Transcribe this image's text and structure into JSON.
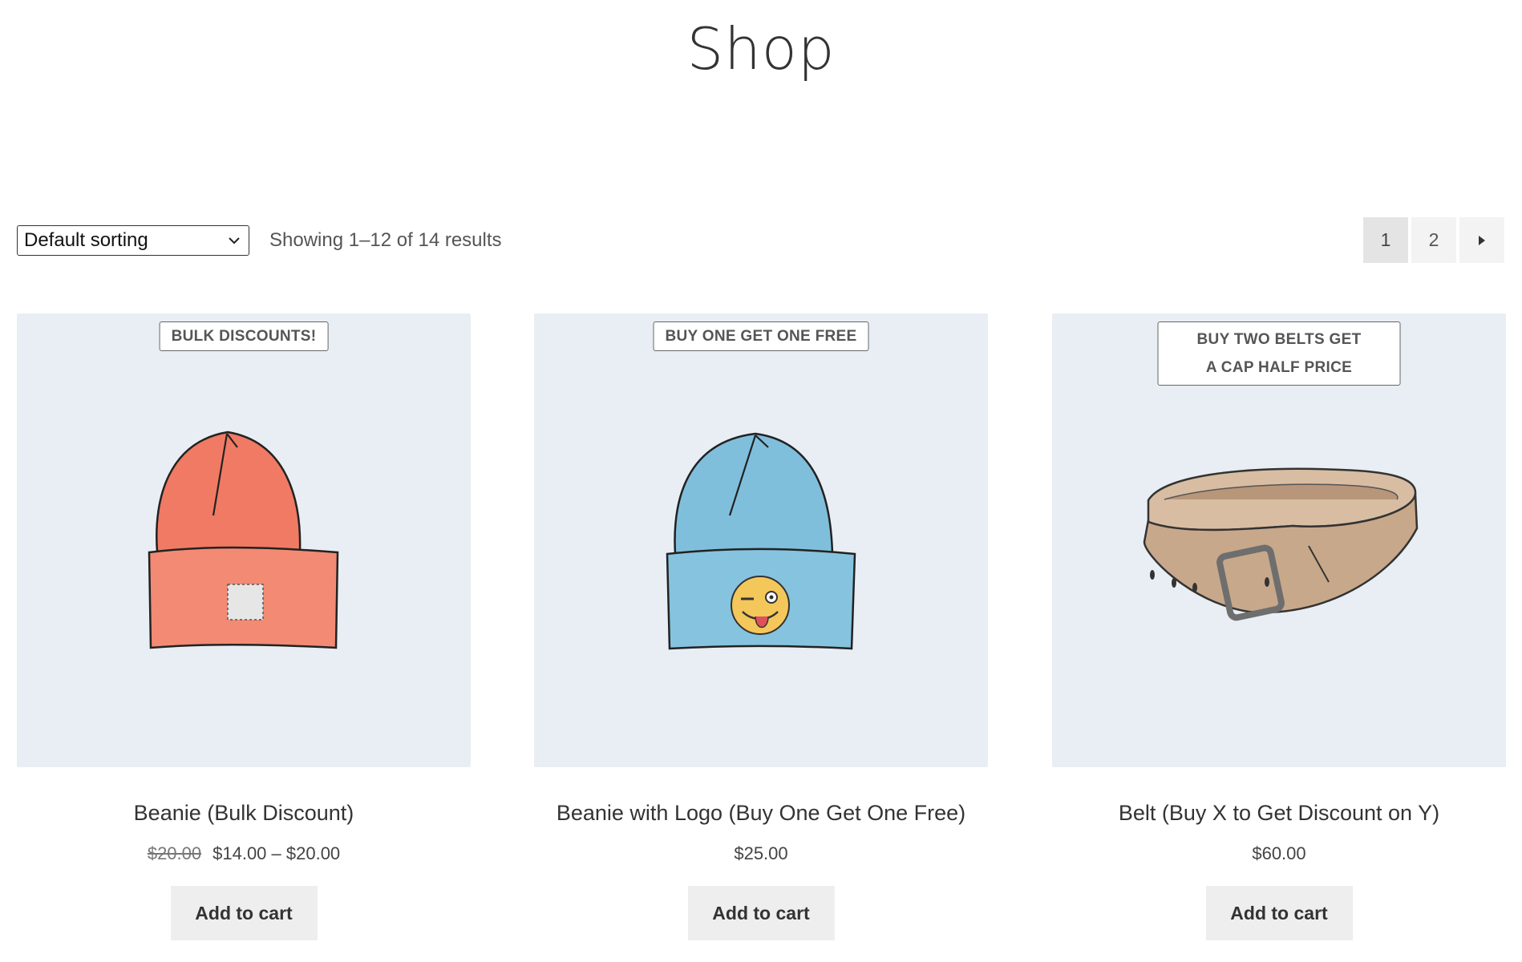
{
  "page": {
    "title": "Shop"
  },
  "toolbar": {
    "sort_selected": "Default sorting",
    "result_count": "Showing 1–12 of 14 results"
  },
  "pagination": {
    "pages": [
      "1",
      "2"
    ],
    "current": "1"
  },
  "products": [
    {
      "badge": "BULK DISCOUNTS!",
      "name": "Beanie (Bulk Discount)",
      "price_old": "$20.00",
      "price": "$14.00 – $20.00",
      "button": "Add to cart",
      "image_icon": "red-beanie-icon"
    },
    {
      "badge": "BUY ONE GET ONE FREE",
      "name": "Beanie with Logo (Buy One Get One Free)",
      "price": "$25.00",
      "button": "Add to cart",
      "image_icon": "blue-beanie-logo-icon"
    },
    {
      "badge_line1": "BUY TWO BELTS GET",
      "badge_line2": "A CAP HALF PRICE",
      "name": "Belt (Buy X to Get Discount on Y)",
      "price": "$60.00",
      "button": "Add to cart",
      "image_icon": "belt-icon"
    }
  ],
  "colors": {
    "image_background": "#e8eef3",
    "button_background": "#eeeeee",
    "beanie_red": "#f07a64",
    "beanie_blue": "#7fbfdc",
    "belt_brown": "#c8a88a"
  }
}
